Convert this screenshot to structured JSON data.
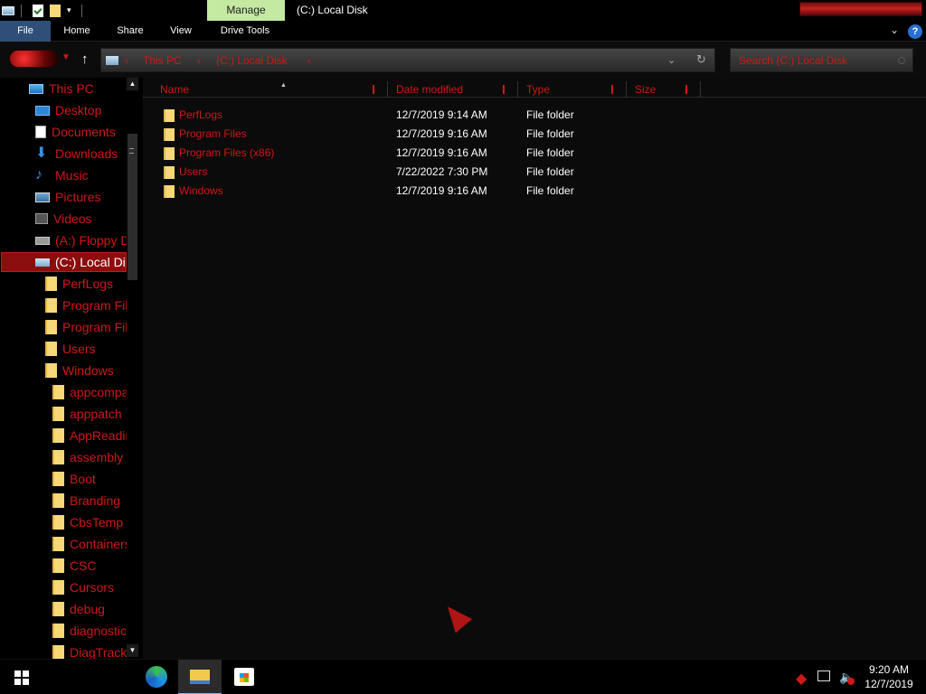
{
  "window": {
    "title": "(C:) Local Disk",
    "manage_tab": "Manage"
  },
  "ribbon": {
    "tabs": [
      "File",
      "Home",
      "Share",
      "View",
      "Drive Tools"
    ],
    "help": "?"
  },
  "address_bar": {
    "crumbs": [
      "This PC",
      "(C:) Local Disk"
    ],
    "search_placeholder": "Search (C:) Local Disk"
  },
  "nav_pane": {
    "items": [
      {
        "label": "This PC",
        "icon": "computer-icon"
      },
      {
        "label": "Desktop",
        "icon": "desktop-icon"
      },
      {
        "label": "Documents",
        "icon": "documents-icon"
      },
      {
        "label": "Downloads",
        "icon": "downloads-icon"
      },
      {
        "label": "Music",
        "icon": "music-icon"
      },
      {
        "label": "Pictures",
        "icon": "pictures-icon"
      },
      {
        "label": "Videos",
        "icon": "videos-icon"
      },
      {
        "label": "(A:) Floppy D",
        "icon": "floppy-drive-icon"
      },
      {
        "label": "(C:) Local Dis",
        "icon": "local-disk-icon",
        "selected": true
      },
      {
        "label": "PerfLogs",
        "icon": "folder-icon"
      },
      {
        "label": "Program File",
        "icon": "folder-icon"
      },
      {
        "label": "Program File",
        "icon": "folder-icon"
      },
      {
        "label": "Users",
        "icon": "folder-icon"
      },
      {
        "label": "Windows",
        "icon": "folder-icon"
      },
      {
        "label": "appcompat",
        "icon": "folder-icon"
      },
      {
        "label": "apppatch",
        "icon": "folder-icon"
      },
      {
        "label": "AppReadin",
        "icon": "folder-icon"
      },
      {
        "label": "assembly",
        "icon": "folder-icon"
      },
      {
        "label": "Boot",
        "icon": "folder-icon"
      },
      {
        "label": "Branding",
        "icon": "folder-icon"
      },
      {
        "label": "CbsTemp",
        "icon": "folder-icon"
      },
      {
        "label": "Containers",
        "icon": "folder-icon"
      },
      {
        "label": "CSC",
        "icon": "folder-icon"
      },
      {
        "label": "Cursors",
        "icon": "folder-icon"
      },
      {
        "label": "debug",
        "icon": "folder-icon"
      },
      {
        "label": "diagnostics",
        "icon": "folder-icon"
      },
      {
        "label": "DiagTrack",
        "icon": "folder-icon"
      }
    ]
  },
  "file_list": {
    "columns": [
      "Name",
      "Date modified",
      "Type",
      "Size"
    ],
    "rows": [
      {
        "name": "PerfLogs",
        "date": "12/7/2019 9:14 AM",
        "type": "File folder",
        "size": ""
      },
      {
        "name": "Program Files",
        "date": "12/7/2019 9:16 AM",
        "type": "File folder",
        "size": ""
      },
      {
        "name": "Program Files (x86)",
        "date": "12/7/2019 9:16 AM",
        "type": "File folder",
        "size": ""
      },
      {
        "name": "Users",
        "date": "7/22/2022 7:30 PM",
        "type": "File folder",
        "size": ""
      },
      {
        "name": "Windows",
        "date": "12/7/2019 9:16 AM",
        "type": "File folder",
        "size": ""
      }
    ]
  },
  "taskbar": {
    "time": "9:20 AM",
    "date": "12/7/2019",
    "pinned": [
      "edge-icon",
      "file-explorer-icon",
      "store-icon"
    ]
  },
  "colors": {
    "accent_red": "#d11818",
    "selected_bg": "#8c0d0d",
    "file_tab_bg": "#2f4f78",
    "manage_tab_bg": "#c4e9a1"
  }
}
